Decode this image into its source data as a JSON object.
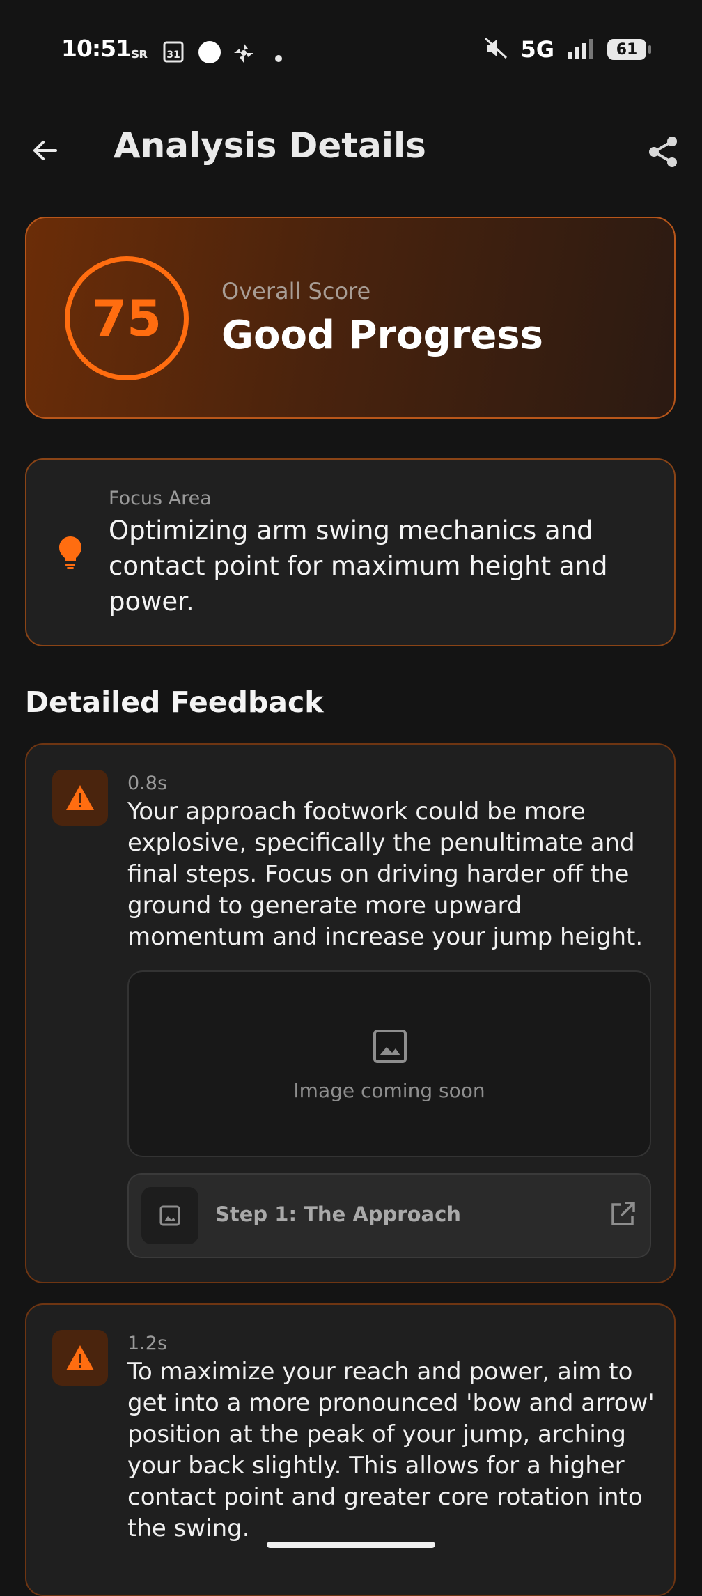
{
  "status_bar": {
    "time": "10:51",
    "network": "5G",
    "battery": "61",
    "icons": [
      "sr-icon",
      "calendar-icon",
      "circle-icon",
      "fan-icon",
      "dot-icon",
      "mute-icon",
      "signal-icon",
      "battery-icon"
    ]
  },
  "app_bar": {
    "title": "Analysis Details",
    "back_icon": "arrow-left-icon",
    "share_icon": "share-icon"
  },
  "score_card": {
    "score": "75",
    "label": "Overall Score",
    "headline": "Good Progress",
    "accent_color": "#ff6d10"
  },
  "focus_card": {
    "label": "Focus Area",
    "text": "Optimizing arm swing mechanics and contact point for maximum height and power.",
    "icon": "lightbulb-icon"
  },
  "section": {
    "title": "Detailed Feedback"
  },
  "feedback": [
    {
      "time": "0.8s",
      "text": "Your approach footwork could be more explosive, specifically the penultimate and final steps. Focus on driving harder off the ground to generate more upward momentum and increase your jump height.",
      "placeholder_text": "Image coming soon",
      "step_label": "Step 1: The Approach"
    },
    {
      "time": "1.2s",
      "text": "To maximize your reach and power, aim to get into a more pronounced 'bow and arrow' position at the peak of your jump, arching your back slightly. This allows for a higher contact point and greater core rotation into the swing."
    }
  ]
}
